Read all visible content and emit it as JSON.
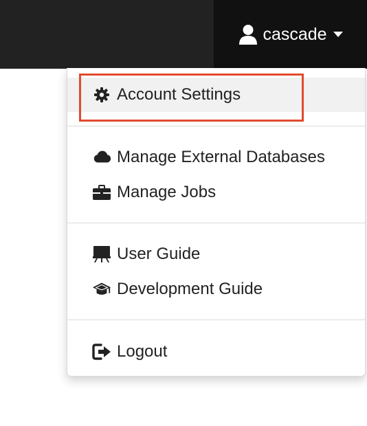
{
  "navbar": {
    "username": "cascade"
  },
  "user_menu": {
    "items": [
      {
        "label": "Account Settings",
        "icon": "gear-icon"
      },
      {
        "label": "Manage External Databases",
        "icon": "cloud-icon"
      },
      {
        "label": "Manage Jobs",
        "icon": "briefcase-icon"
      },
      {
        "label": "User Guide",
        "icon": "presentation-icon"
      },
      {
        "label": "Development Guide",
        "icon": "graduation-cap-icon"
      },
      {
        "label": "Logout",
        "icon": "sign-out-icon"
      }
    ]
  },
  "highlight_color": "#e14a2d"
}
